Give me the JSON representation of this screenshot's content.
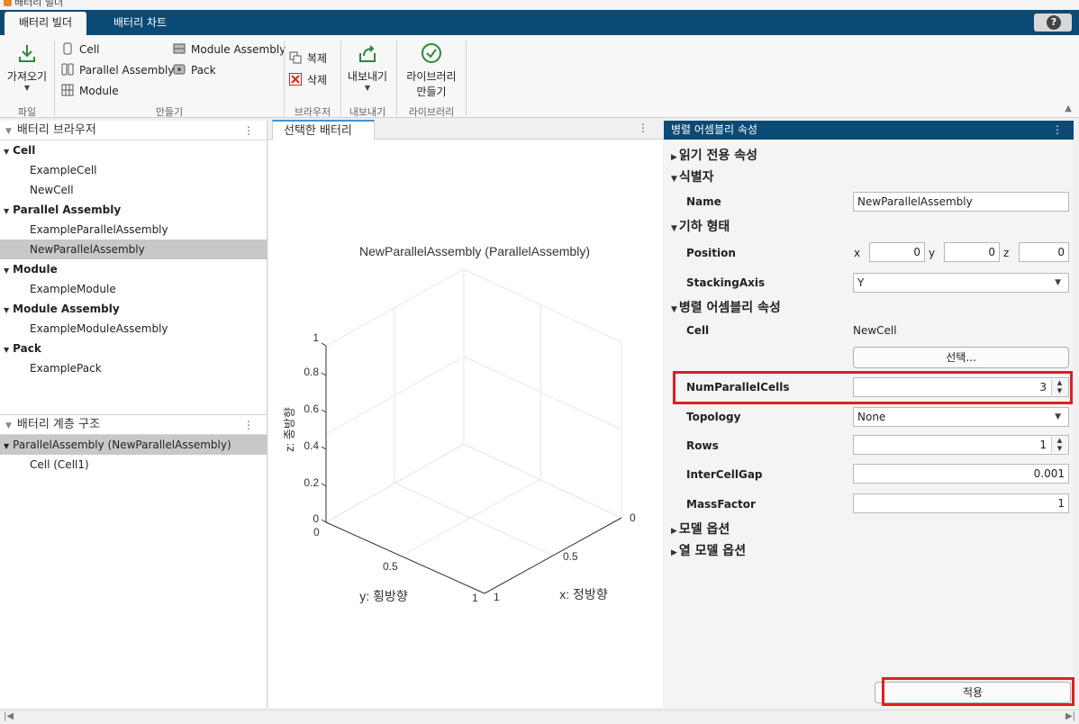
{
  "window": {
    "title": "배터리 빌더"
  },
  "tabs": [
    {
      "label": "배터리 빌더",
      "active": true
    },
    {
      "label": "배터리 차트",
      "active": false
    }
  ],
  "help": {
    "label": "?"
  },
  "ribbon": {
    "import_label": "가져오기",
    "create": {
      "cell": "Cell",
      "parallel_assembly": "Parallel Assembly",
      "module": "Module",
      "module_assembly": "Module Assembly",
      "pack": "Pack"
    },
    "copy_label": "복제",
    "delete_label": "삭제",
    "export_label": "내보내기",
    "library_label_line1": "라이브러리",
    "library_label_line2": "만들기",
    "groups": {
      "file": "파일",
      "create": "만들기",
      "browser": "브라우저",
      "export": "내보내기",
      "library": "라이브러리"
    }
  },
  "browser": {
    "title": "배터리 브라우저",
    "groups": [
      {
        "label": "Cell",
        "items": [
          "ExampleCell",
          "NewCell"
        ]
      },
      {
        "label": "Parallel Assembly",
        "items": [
          "ExampleParallelAssembly",
          "NewParallelAssembly"
        ]
      },
      {
        "label": "Module",
        "items": [
          "ExampleModule"
        ]
      },
      {
        "label": "Module Assembly",
        "items": [
          "ExampleModuleAssembly"
        ]
      },
      {
        "label": "Pack",
        "items": [
          "ExamplePack"
        ]
      }
    ],
    "selected": "NewParallelAssembly"
  },
  "hierarchy": {
    "title": "배터리 계층 구조",
    "root": "ParallelAssembly (NewParallelAssembly)",
    "child": "Cell (Cell1)"
  },
  "viewer": {
    "tab_label": "선택한 배터리",
    "plot_title": "NewParallelAssembly (ParallelAssembly)",
    "zlabel": "z: 종방향",
    "ylabel": "y: 횡방향",
    "xlabel": "x: 정방향",
    "z_ticks": [
      "0",
      "0.2",
      "0.4",
      "0.6",
      "0.8",
      "1"
    ],
    "y_ticks": [
      "0",
      "0.5",
      "1"
    ],
    "x_ticks": [
      "0",
      "0.5",
      "1"
    ]
  },
  "props": {
    "title": "병렬 어셈블리 속성",
    "sections": {
      "readonly": "읽기 전용 속성",
      "identifier": "식별자",
      "geometry": "기하 형태",
      "pa_props": "병렬 어셈블리 속성",
      "model_opts": "모델 옵션",
      "thermal_opts": "열 모델 옵션"
    },
    "name_label": "Name",
    "name_value": "NewParallelAssembly",
    "position_label": "Position",
    "pos_x_label": "x",
    "pos_x": "0",
    "pos_y_label": "y",
    "pos_y": "0",
    "pos_z_label": "z",
    "pos_z": "0",
    "stacking_label": "StackingAxis",
    "stacking_value": "Y",
    "cell_label": "Cell",
    "cell_value": "NewCell",
    "select_button": "선택...",
    "num_parallel_label": "NumParallelCells",
    "num_parallel_value": "3",
    "topology_label": "Topology",
    "topology_value": "None",
    "rows_label": "Rows",
    "rows_value": "1",
    "gap_label": "InterCellGap",
    "gap_value": "0.001",
    "mass_label": "MassFactor",
    "mass_value": "1",
    "apply_button": "적용"
  },
  "colors": {
    "accent": "#0b4a75",
    "highlight": "#e01e1e"
  }
}
